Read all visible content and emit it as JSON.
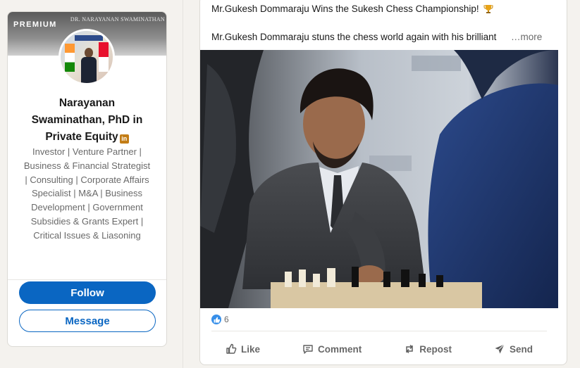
{
  "profile": {
    "premium_label": "PREMIUM",
    "cover_text": "DR. NARAYANAN SWAMINATHAN",
    "name_line": "Narayanan Swaminathan, PhD in Private Equity",
    "badge": "in",
    "headline": "Investor | Venture Partner | Business & Financial Strategist | Consulting | Corporate Affairs Specialist | M&A | Business Development | Government Subsidies & Grants Expert | Critical Issues & Liasoning",
    "follow_label": "Follow",
    "message_label": "Message"
  },
  "post": {
    "title": "Mr.Gukesh Dommaraju Wins the Sukesh Chess Championship!",
    "body": "Mr.Gukesh Dommaraju stuns the chess world again with his brilliant",
    "more_label": "…more",
    "reaction_count": "6",
    "actions": {
      "like": "Like",
      "comment": "Comment",
      "repost": "Repost",
      "send": "Send"
    }
  },
  "colors": {
    "accent": "#0a66c2",
    "background": "#f4f2ee",
    "premium_badge": "#c37d16"
  },
  "icons": [
    "trophy-icon",
    "like-reaction-icon",
    "like-icon",
    "comment-icon",
    "repost-icon",
    "send-icon"
  ]
}
